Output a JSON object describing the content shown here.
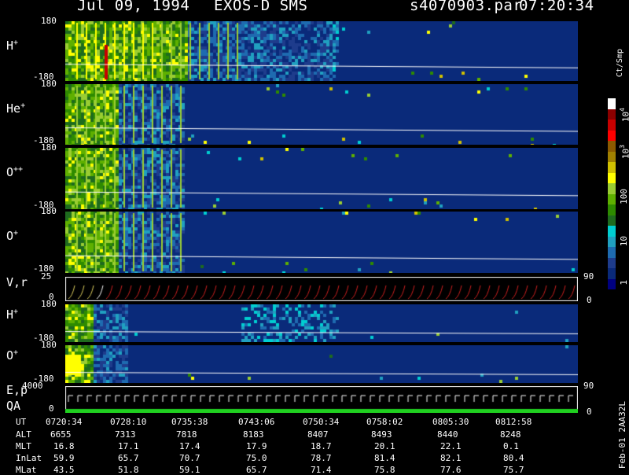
{
  "header": {
    "date": "Jul 09, 1994",
    "instrument": "EXOS-D SMS",
    "file": "s4070903.par",
    "time": "07:20:34"
  },
  "panels": [
    {
      "label": "H",
      "sup": "+",
      "ymax": "180",
      "ymin": "-180"
    },
    {
      "label": "He",
      "sup": "+",
      "ymax": "180",
      "ymin": "-180"
    },
    {
      "label": "O",
      "sup": "++",
      "ymax": "180",
      "ymin": "-180"
    },
    {
      "label": "O",
      "sup": "+",
      "ymax": "180",
      "ymin": "-180"
    },
    {
      "label": "V,r",
      "sup": "",
      "ymax": "25",
      "ymin": "0",
      "right_top": "90",
      "right_bottom": "0"
    },
    {
      "label": "H",
      "sup": "+",
      "ymax": "180",
      "ymin": "-180"
    },
    {
      "label": "O",
      "sup": "+",
      "ymax": "180",
      "ymin": "-180"
    },
    {
      "label": "E,p",
      "sup": "",
      "label2": "QA",
      "ymax": "4000",
      "ymin": "0",
      "right_top": "90",
      "right_bottom": "0"
    }
  ],
  "colorbar": {
    "unit": "Ct/Smp",
    "ticks": [
      "10",
      "10",
      "100",
      "10",
      "10",
      "1"
    ],
    "tick_exps": [
      "4",
      "3",
      "",
      "",
      "",
      ""
    ],
    "colors": [
      "#ffffff",
      "#8b0000",
      "#c80000",
      "#ff0000",
      "#8b5a00",
      "#a08000",
      "#d0c000",
      "#ffff00",
      "#9acd32",
      "#5fb000",
      "#2e8b00",
      "#1e6b1e",
      "#00ced1",
      "#20a0c0",
      "#1e6bb0",
      "#1e3c8c",
      "#0a2a7a",
      "#000080"
    ]
  },
  "ephemeris": {
    "row_labels": [
      "UT",
      "ALT",
      "MLT",
      "InLat",
      "MLat"
    ],
    "columns": [
      [
        "0720:34",
        "6655",
        "16.8",
        "59.9",
        "43.5"
      ],
      [
        "0728:10",
        "7313",
        "17.1",
        "65.7",
        "51.8"
      ],
      [
        "0735:38",
        "7818",
        "17.4",
        "70.7",
        "59.1"
      ],
      [
        "0743:06",
        "8183",
        "17.9",
        "75.0",
        "65.7"
      ],
      [
        "0750:34",
        "8407",
        "18.7",
        "78.7",
        "71.4"
      ],
      [
        "0758:02",
        "8493",
        "20.1",
        "81.4",
        "75.8"
      ],
      [
        "0805:30",
        "8440",
        "22.1",
        "82.1",
        "77.6"
      ],
      [
        "0812:58",
        "8248",
        "0.1",
        "80.4",
        "75.7"
      ]
    ]
  },
  "footer_code": "Feb-01 2AA32L"
}
